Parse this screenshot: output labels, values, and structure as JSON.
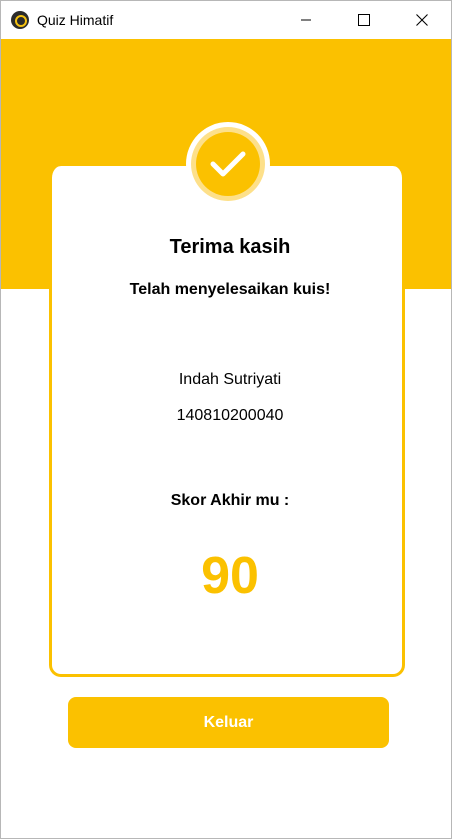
{
  "window": {
    "title": "Quiz Himatif",
    "icons": [
      "app-logo-icon",
      "minimize-icon",
      "maximize-icon",
      "close-icon"
    ]
  },
  "result": {
    "heading": "Terima kasih",
    "subheading": "Telah menyelesaikan kuis!",
    "name": "Indah Sutriyati",
    "student_id": "140810200040",
    "score_label": "Skor Akhir mu :",
    "score": "90"
  },
  "actions": {
    "exit_label": "Keluar"
  },
  "colors": {
    "accent": "#fbc100",
    "accent_light": "#fde08a",
    "button_text": "#ffffff"
  }
}
